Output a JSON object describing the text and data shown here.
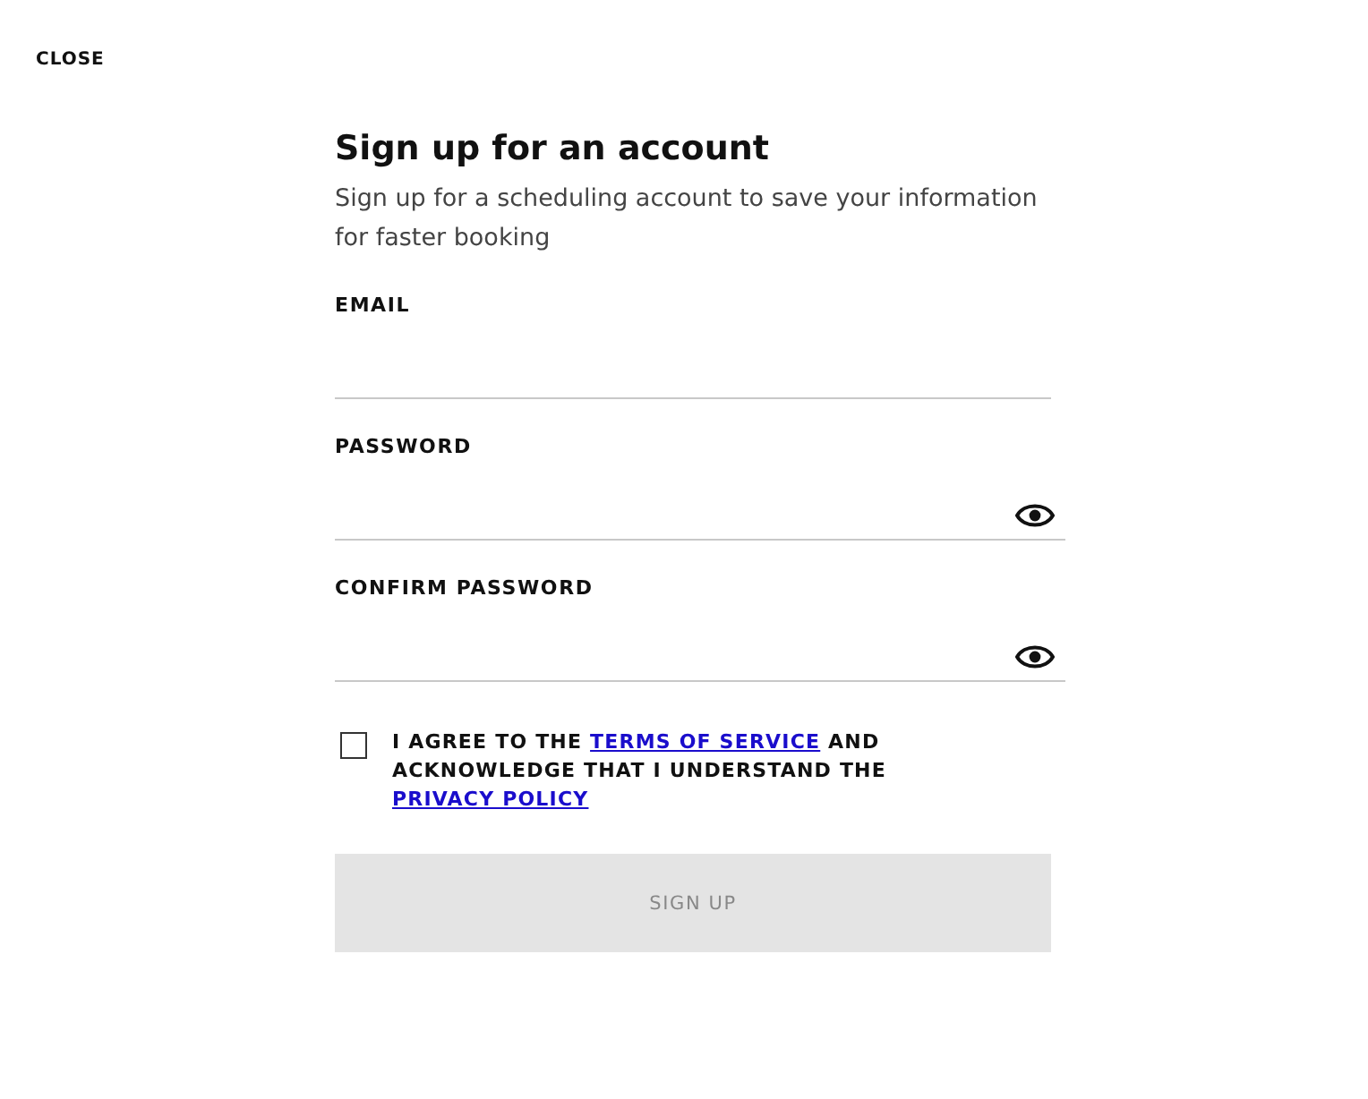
{
  "close_link": "CLOSE",
  "title": "Sign up for an account",
  "subtitle": "Sign up for a scheduling account to save your information for faster booking",
  "fields": [
    {
      "label": "EMAIL",
      "kind": "text"
    },
    {
      "label": "PASSWORD",
      "kind": "password"
    },
    {
      "label": "CONFIRM PASSWORD",
      "kind": "password"
    }
  ],
  "agreement": {
    "checked": false,
    "parts": [
      {
        "kind": "text",
        "text": "I AGREE TO THE "
      },
      {
        "kind": "link",
        "text": "TERMS OF SERVICE"
      },
      {
        "kind": "text",
        "text": " AND ACKNOWLEDGE THAT I UNDERSTAND THE "
      },
      {
        "kind": "link",
        "text": "PRIVACY POLICY"
      }
    ]
  },
  "submit": {
    "label": "SIGN UP",
    "disabled": true
  }
}
